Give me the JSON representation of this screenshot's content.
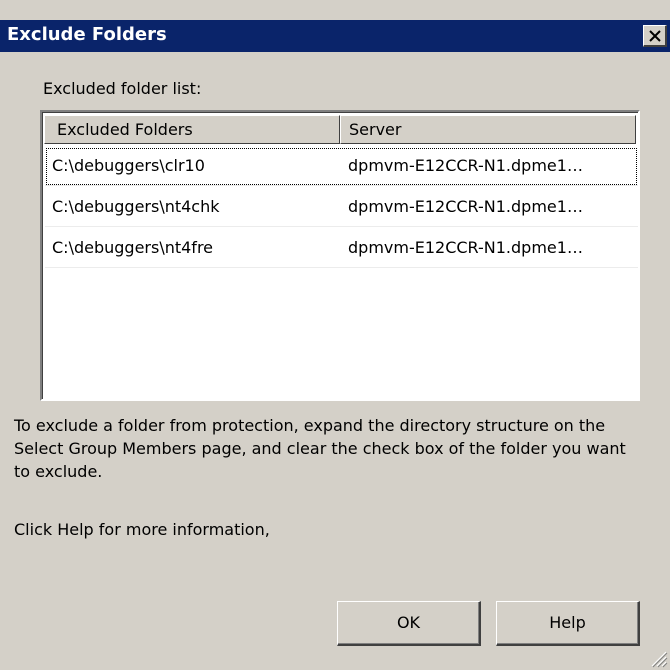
{
  "window": {
    "title": "Exclude Folders",
    "close_glyph": "✕"
  },
  "list": {
    "label": "Excluded folder list:",
    "columns": [
      "Excluded Folders",
      "Server"
    ],
    "rows": [
      {
        "folder": "C:\\debuggers\\clr10",
        "server": "dpmvm-E12CCR-N1.dpme1…"
      },
      {
        "folder": "C:\\debuggers\\nt4chk",
        "server": "dpmvm-E12CCR-N1.dpme1…"
      },
      {
        "folder": "C:\\debuggers\\nt4fre",
        "server": "dpmvm-E12CCR-N1.dpme1…"
      }
    ]
  },
  "instructions": {
    "text": "To exclude a folder from protection, expand the directory structure on the Select Group Members page, and clear the check box of the folder you want to exclude.",
    "help_hint": "Click Help for more information,"
  },
  "buttons": {
    "ok_label": "OK",
    "help_label": "Help"
  },
  "icons": {
    "close": "close-icon",
    "resize": "resize-grip-icon"
  },
  "colors": {
    "titlebar": "#0a246a",
    "dialog_face": "#d4d0c8",
    "list_background": "#ffffff"
  }
}
